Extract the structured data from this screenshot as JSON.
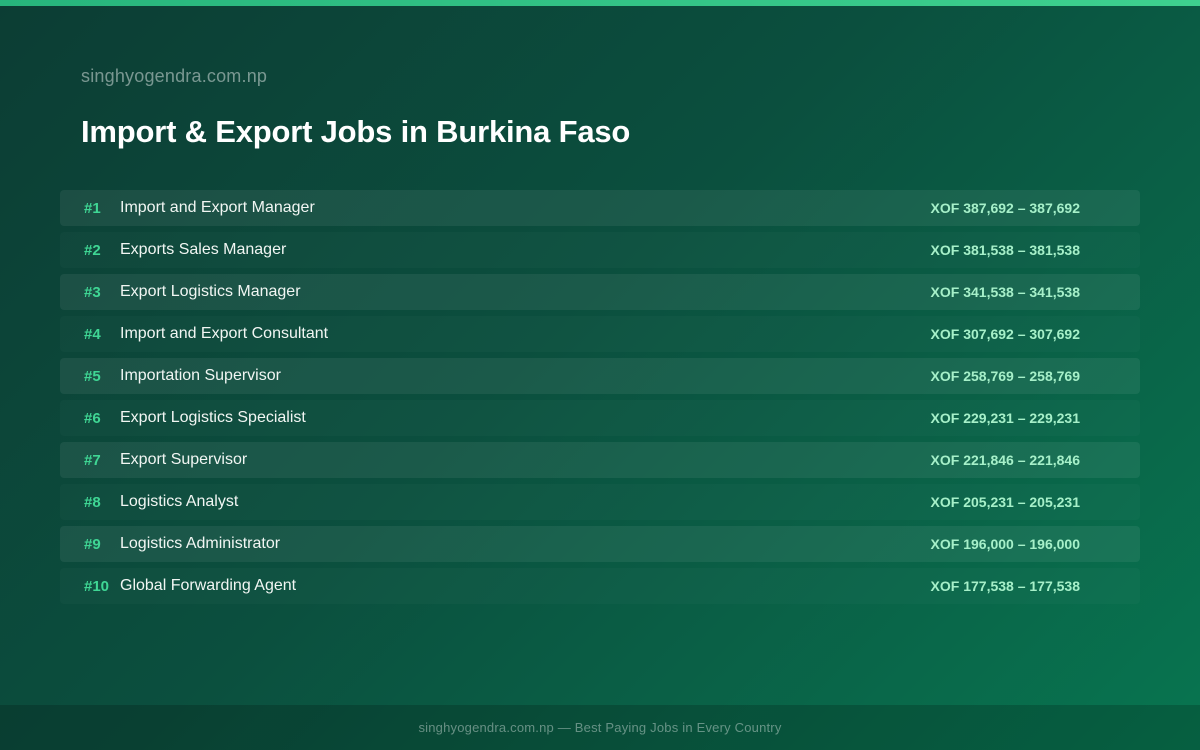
{
  "header": {
    "site_name": "singhyogendra.com.np",
    "title": "Import & Export Jobs in Burkina Faso"
  },
  "jobs": [
    {
      "rank": "#1",
      "title": "Import and Export Manager",
      "salary": "XOF 387,692 – 387,692"
    },
    {
      "rank": "#2",
      "title": "Exports Sales Manager",
      "salary": "XOF 381,538 – 381,538"
    },
    {
      "rank": "#3",
      "title": "Export Logistics Manager",
      "salary": "XOF 341,538 – 341,538"
    },
    {
      "rank": "#4",
      "title": "Import and Export Consultant",
      "salary": "XOF 307,692 – 307,692"
    },
    {
      "rank": "#5",
      "title": "Importation Supervisor",
      "salary": "XOF 258,769 – 258,769"
    },
    {
      "rank": "#6",
      "title": "Export Logistics Specialist",
      "salary": "XOF 229,231 – 229,231"
    },
    {
      "rank": "#7",
      "title": "Export Supervisor",
      "salary": "XOF 221,846 – 221,846"
    },
    {
      "rank": "#8",
      "title": "Logistics Analyst",
      "salary": "XOF 205,231 – 205,231"
    },
    {
      "rank": "#9",
      "title": "Logistics Administrator",
      "salary": "XOF 196,000 – 196,000"
    },
    {
      "rank": "#10",
      "title": "Global Forwarding Agent",
      "salary": "XOF 177,538 – 177,538"
    }
  ],
  "footer": {
    "text": "singhyogendra.com.np — Best Paying Jobs in Every Country"
  },
  "colors": {
    "accent": "#3fd694",
    "salary": "#a6f0c9",
    "background_start": "#0c3d34",
    "background_end": "#087550"
  }
}
